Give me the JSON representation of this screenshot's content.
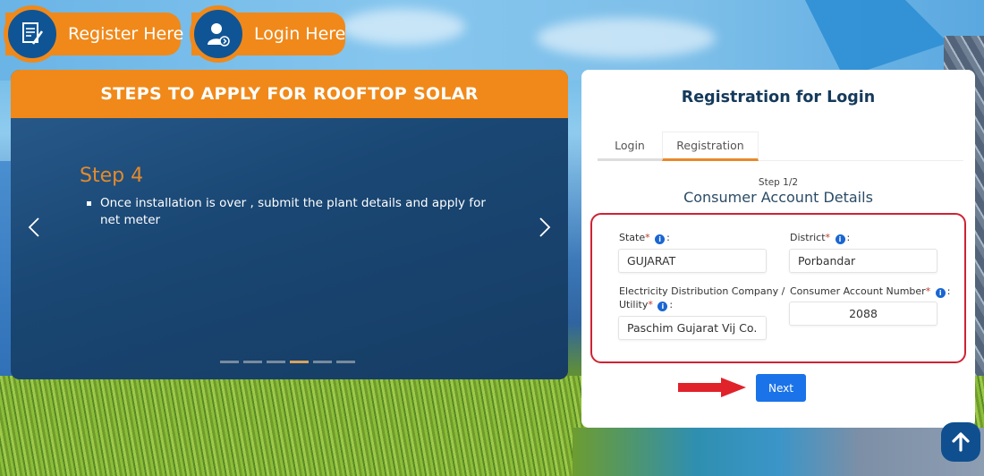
{
  "header": {
    "register_label": "Register Here",
    "login_label": "Login Here",
    "register_icon": "document-edit-icon",
    "login_icon": "user-login-icon"
  },
  "carousel": {
    "title": "STEPS TO APPLY FOR ROOFTOP SOLAR",
    "step_title": "Step 4",
    "step_items": [
      "Once installation is over , submit the plant details and apply for net meter"
    ],
    "prev_icon": "‹",
    "next_icon": "›",
    "slide_count": 6,
    "active_slide": 4
  },
  "form": {
    "title": "Registration for Login",
    "tabs": [
      {
        "label": "Login",
        "active": false
      },
      {
        "label": "Registration",
        "active": true
      }
    ],
    "step_number": "Step 1/2",
    "step_heading": "Consumer Account Details",
    "fields": {
      "state": {
        "label": "State",
        "required_mark": "*",
        "suffix": ":",
        "value": "GUJARAT"
      },
      "district": {
        "label": "District",
        "required_mark": "*",
        "suffix": ":",
        "value": "Porbandar"
      },
      "utility": {
        "label_line1": "Electricity Distribution Company /",
        "label_line2": "Utility",
        "required_mark": "*",
        "suffix": ":",
        "value": "Paschim Gujarat Vij Co. Ltd."
      },
      "account": {
        "label": "Consumer Account Number",
        "required_mark": "*",
        "suffix": ":",
        "value": "2088"
      }
    },
    "info_glyph": "i",
    "next_label": "Next"
  },
  "colors": {
    "accent_orange": "#f0891a",
    "navy": "#0f5596",
    "primary_blue": "#1a73e8",
    "highlight_red": "#cf2233"
  },
  "scroll_top_icon": "arrow-up-icon"
}
